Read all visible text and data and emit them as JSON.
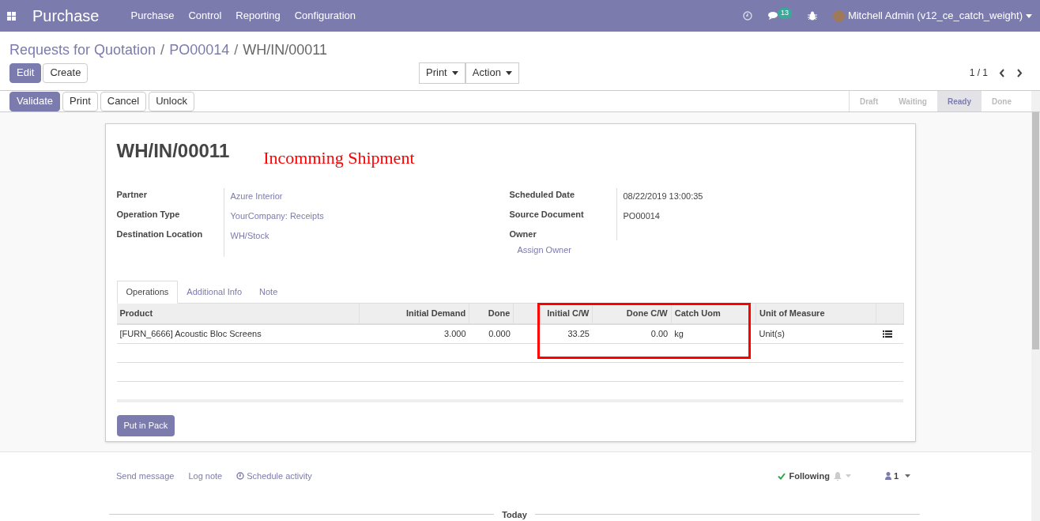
{
  "navbar": {
    "app_name": "Purchase",
    "menu": [
      "Purchase",
      "Control",
      "Reporting",
      "Configuration"
    ],
    "message_count": "13",
    "user": "Mitchell Admin (v12_ce_catch_weight)"
  },
  "breadcrumb_separator": "/",
  "breadcrumb": [
    {
      "label": "Requests for Quotation",
      "link": true
    },
    {
      "label": "PO00014",
      "link": true
    },
    {
      "label": "WH/IN/00011",
      "link": false
    }
  ],
  "control_buttons": [
    {
      "label": "Edit",
      "primary": true
    },
    {
      "label": "Create",
      "primary": false
    }
  ],
  "dropdowns": [
    "Print",
    "Action"
  ],
  "pager": "1 / 1",
  "action_buttons": [
    {
      "label": "Validate",
      "primary": true
    },
    {
      "label": "Print",
      "primary": false
    },
    {
      "label": "Cancel",
      "primary": false
    },
    {
      "label": "Unlock",
      "primary": false
    }
  ],
  "statuses": [
    {
      "label": "Draft",
      "selected": false
    },
    {
      "label": "Waiting",
      "selected": false
    },
    {
      "label": "Ready",
      "selected": true
    },
    {
      "label": "Done",
      "selected": false
    }
  ],
  "sheet": {
    "title": "WH/IN/00011",
    "annotation": "Incomming Shipment",
    "left_fields": [
      {
        "label": "Partner",
        "value": "Azure Interior"
      },
      {
        "label": "Operation Type",
        "value": "YourCompany: Receipts"
      },
      {
        "label": "Destination Location",
        "value": "WH/Stock"
      }
    ],
    "right_fields": [
      {
        "label": "Scheduled Date",
        "value": "08/22/2019 13:00:35"
      },
      {
        "label": "Source Document",
        "value": "PO00014"
      },
      {
        "label": "Owner"
      }
    ],
    "assign_owner": "Assign Owner",
    "tabs": [
      {
        "label": "Operations",
        "selected": true
      },
      {
        "label": "Additional Info",
        "selected": false
      },
      {
        "label": "Note",
        "selected": false
      }
    ],
    "table": {
      "columns": [
        {
          "label": "Product",
          "kind": "text"
        },
        {
          "label": "Initial Demand",
          "kind": "number"
        },
        {
          "label": "Done",
          "kind": "number"
        },
        {
          "kind": "text"
        },
        {
          "label": "Initial C/W",
          "kind": "number"
        },
        {
          "label": "Done C/W",
          "kind": "number"
        },
        {
          "label": "Catch Uom",
          "kind": "text"
        },
        {
          "label": "Unit of Measure",
          "kind": "text"
        },
        {
          "kind": "text"
        }
      ],
      "rows": [
        [
          "[FURN_6666] Acoustic Bloc Screens",
          "3.000",
          "0.000",
          "",
          "33.25",
          "0.00",
          "kg",
          "Unit(s)",
          ""
        ]
      ]
    },
    "pack_button": "Put in Pack"
  },
  "chatter": {
    "actions": [
      "Send message",
      "Log note",
      "Schedule activity"
    ],
    "following": "Following",
    "followers": "1",
    "divider": "Today"
  }
}
